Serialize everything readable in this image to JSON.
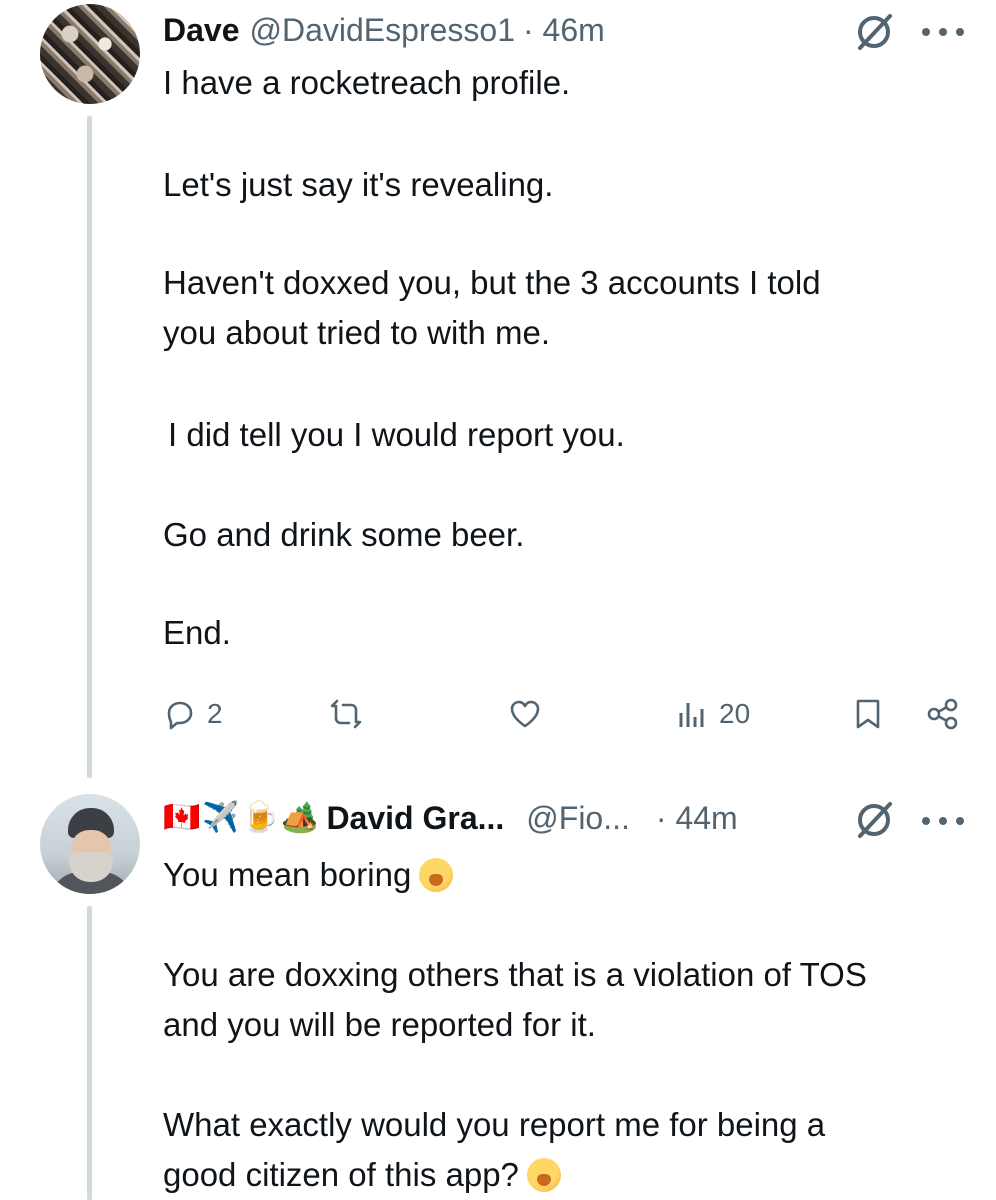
{
  "posts": [
    {
      "author_name": "Dave",
      "handle": "@DavidEspresso1",
      "time": "· 46m",
      "paragraphs": [
        "I have a rocketreach profile.",
        "Let's just say it's revealing.",
        "Haven't doxxed you, but the 3 accounts I told",
        "you about tried to with me.",
        "I did tell you I would report you.",
        "Go and drink some beer.",
        "End."
      ],
      "actions": {
        "reply_count": "2",
        "views_count": "20"
      }
    },
    {
      "flair": [
        "🇨🇦",
        "✈️",
        "🍺",
        "🏕️"
      ],
      "author_name": "David Gra...",
      "handle": "@Fio...",
      "time": "· 44m",
      "paragraphs": [
        "You mean boring",
        "You are doxxing others that is a violation of TOS",
        "and you will be reported for it.",
        "What exactly would you report me for being a",
        "good citizen of this app?"
      ]
    }
  ],
  "icons": {
    "grok": "grok-icon",
    "more": "more-icon",
    "reply": "reply-icon",
    "repost": "repost-icon",
    "like": "like-icon",
    "views": "views-icon",
    "bookmark": "bookmark-icon",
    "share": "share-icon",
    "emoji": "yawning-face-icon"
  },
  "colors": {
    "text": "#0f1419",
    "secondary": "#536471",
    "thread_line": "#cfd9de"
  }
}
